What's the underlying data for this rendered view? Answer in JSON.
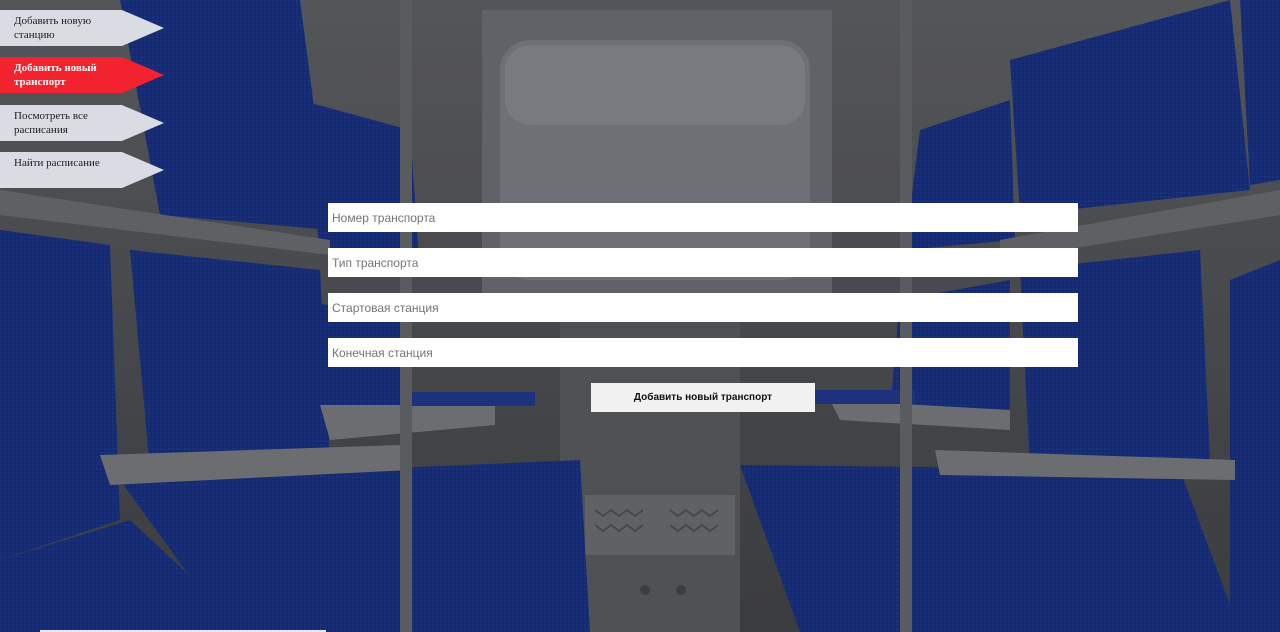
{
  "nav": {
    "items": [
      {
        "label": "Добавить новую станцию",
        "active": false
      },
      {
        "label": "Добавить новый транспорт",
        "active": true
      },
      {
        "label": "Посмотреть все расписания",
        "active": false
      },
      {
        "label": "Найти расписание",
        "active": false
      }
    ]
  },
  "form": {
    "transport_number": {
      "placeholder": "Номер транспорта",
      "value": ""
    },
    "transport_type": {
      "placeholder": "Тип транспорта",
      "value": ""
    },
    "start_station": {
      "placeholder": "Стартовая станция",
      "value": ""
    },
    "end_station": {
      "placeholder": "Конечная станция",
      "value": ""
    },
    "submit_label": "Добавить новый транспорт"
  },
  "colors": {
    "nav_default": "#d9dde3",
    "nav_active": "#f2232f",
    "seat_blue": "#1f3d9c"
  },
  "background": {
    "image": "train-compartment-interior"
  }
}
